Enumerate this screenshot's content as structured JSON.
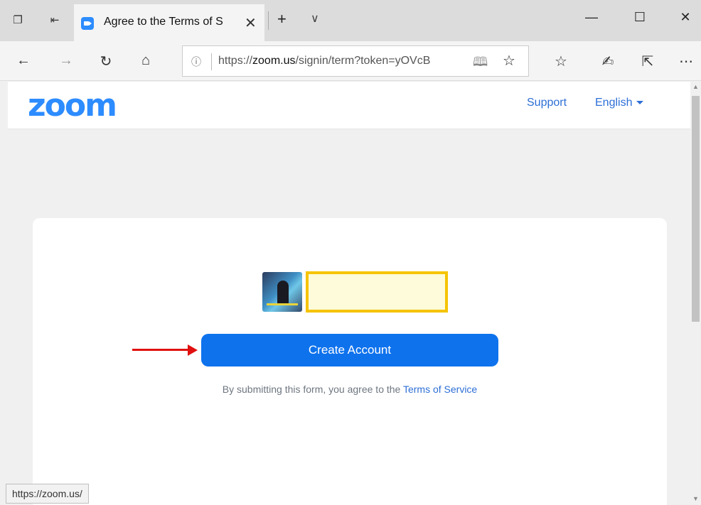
{
  "browser": {
    "tab_title": "Agree to the Terms of S",
    "url_domain": "zoom.us",
    "url_prefix": "https://",
    "url_rest": "/signin/term?token=yOVcB",
    "status_url": "https://zoom.us/"
  },
  "header": {
    "logo": "zoom",
    "support_label": "Support",
    "language_label": "English"
  },
  "main": {
    "create_button_label": "Create Account",
    "terms_prefix": "By submitting this form, you agree to the ",
    "terms_link": "Terms of Service"
  },
  "colors": {
    "brand": "#2d8cff",
    "button": "#0e72ed",
    "highlight_border": "#f5c400",
    "arrow": "#e01010"
  }
}
